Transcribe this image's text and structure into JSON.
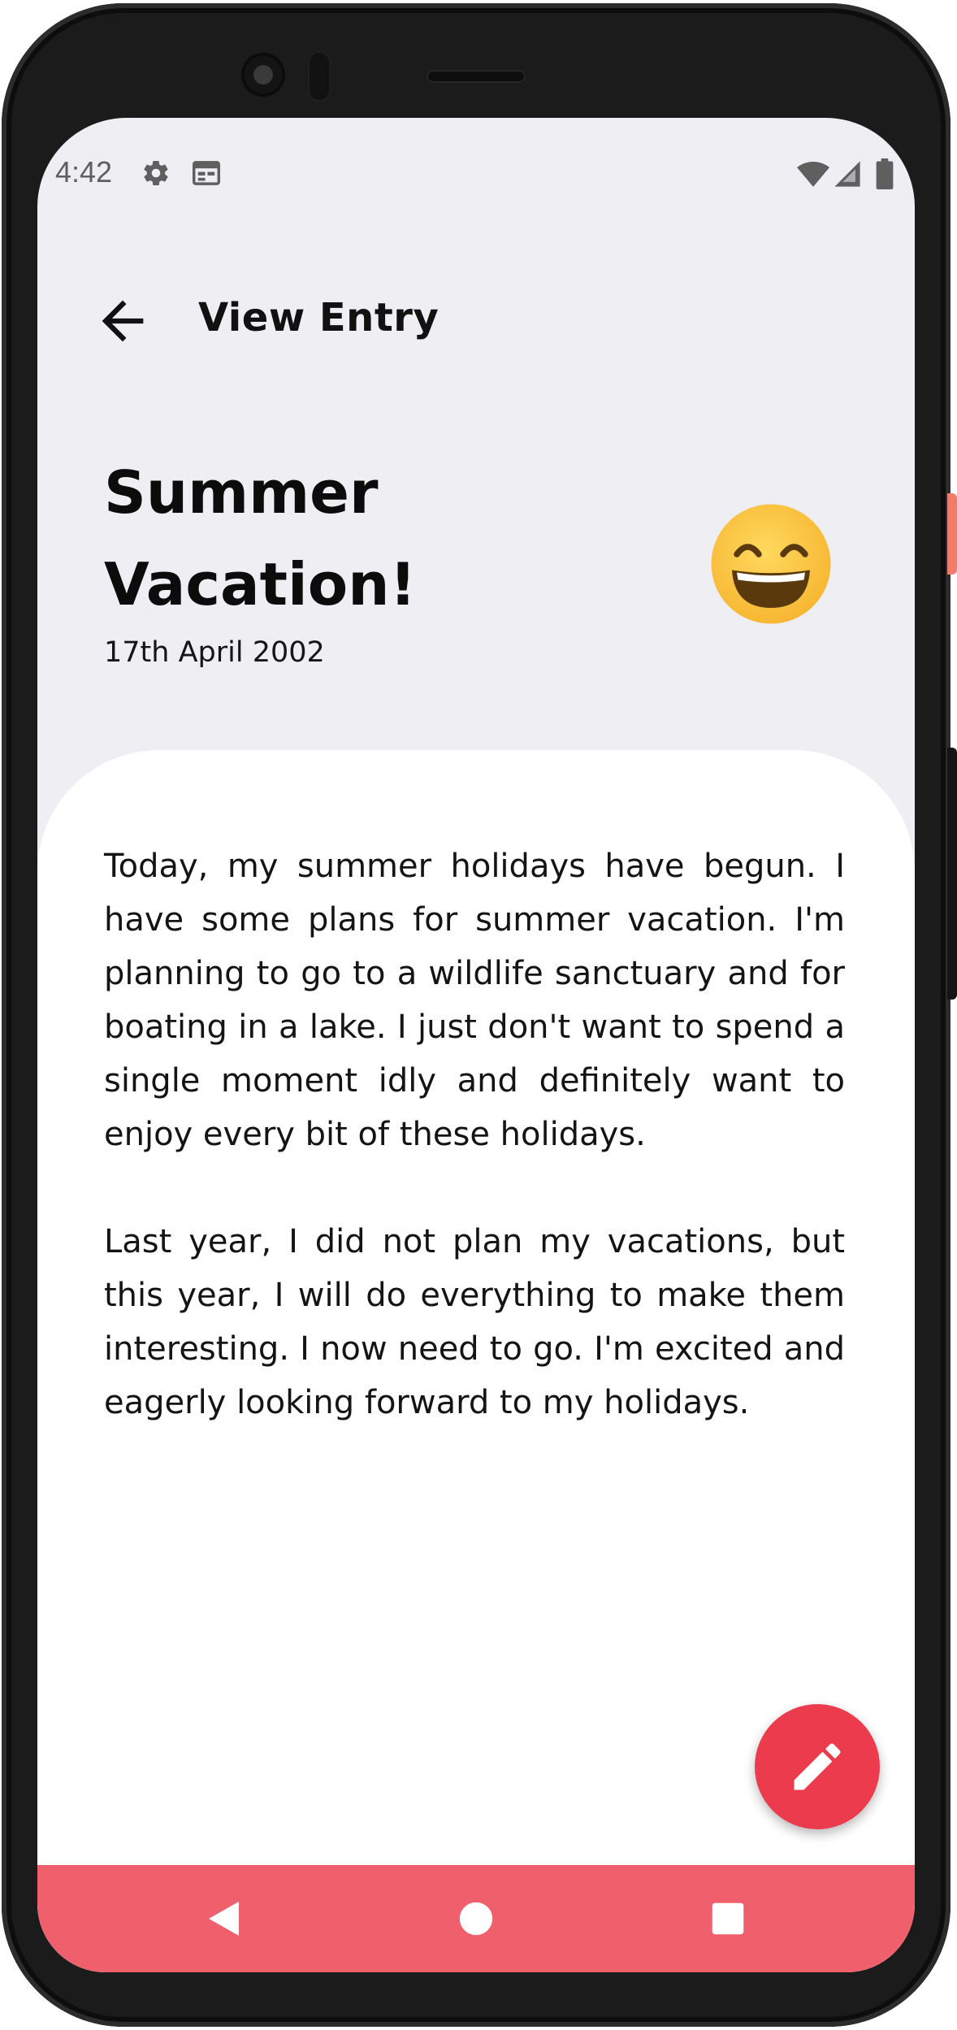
{
  "status_bar": {
    "time": "4:42",
    "icons": [
      "gear-icon",
      "calendar-icon",
      "wifi-icon",
      "signal-icon",
      "battery-icon"
    ]
  },
  "app_bar": {
    "back_icon": "arrow-left-icon",
    "title": "View Entry"
  },
  "entry": {
    "title": "Summer Vacation!",
    "date": "17th April 2002",
    "mood_icon": "grinning-face-emoji",
    "paragraphs": [
      "Today, my summer holidays have begun. I have some plans for summer vacation. I'm planning to go to a wildlife sanctuary and for boating in a lake. I just don't want to spend a single moment idly and definitely want to enjoy every bit of these holidays.",
      "Last year, I did not plan my vacations, but this year, I will do everything to make them interesting. I now need to go. I'm excited and eagerly looking forward to my holidays."
    ]
  },
  "fab": {
    "icon": "pencil-icon"
  },
  "nav_bar": {
    "items": [
      "back-triangle-icon",
      "home-circle-icon",
      "recents-square-icon"
    ]
  },
  "colors": {
    "screen_background": "#efeef2",
    "card_background": "#ffffff",
    "accent": "#ec3b4c",
    "nav_bar": "#f0606c",
    "emoji_yellow": "#fdcb4e"
  }
}
